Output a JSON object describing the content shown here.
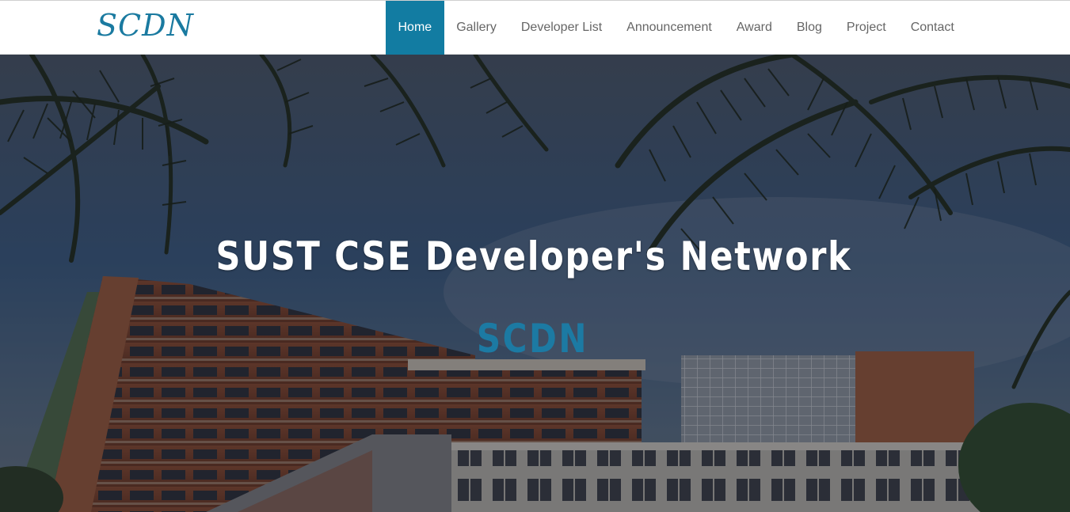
{
  "brand": {
    "logo_text": "SCDN",
    "color": "#1a7aa0"
  },
  "nav": {
    "active_color": "#127ca2",
    "items": [
      {
        "label": "Home",
        "active": true
      },
      {
        "label": "Gallery",
        "active": false
      },
      {
        "label": "Developer List",
        "active": false
      },
      {
        "label": "Announcement",
        "active": false
      },
      {
        "label": "Award",
        "active": false
      },
      {
        "label": "Blog",
        "active": false
      },
      {
        "label": "Project",
        "active": false
      },
      {
        "label": "Contact",
        "active": false
      }
    ]
  },
  "hero": {
    "title": "SUST CSE Developer's Network",
    "subtitle": "SCDN",
    "subtitle_color": "#1c7aa3",
    "background_image": "campus-building-with-palm-trees"
  }
}
